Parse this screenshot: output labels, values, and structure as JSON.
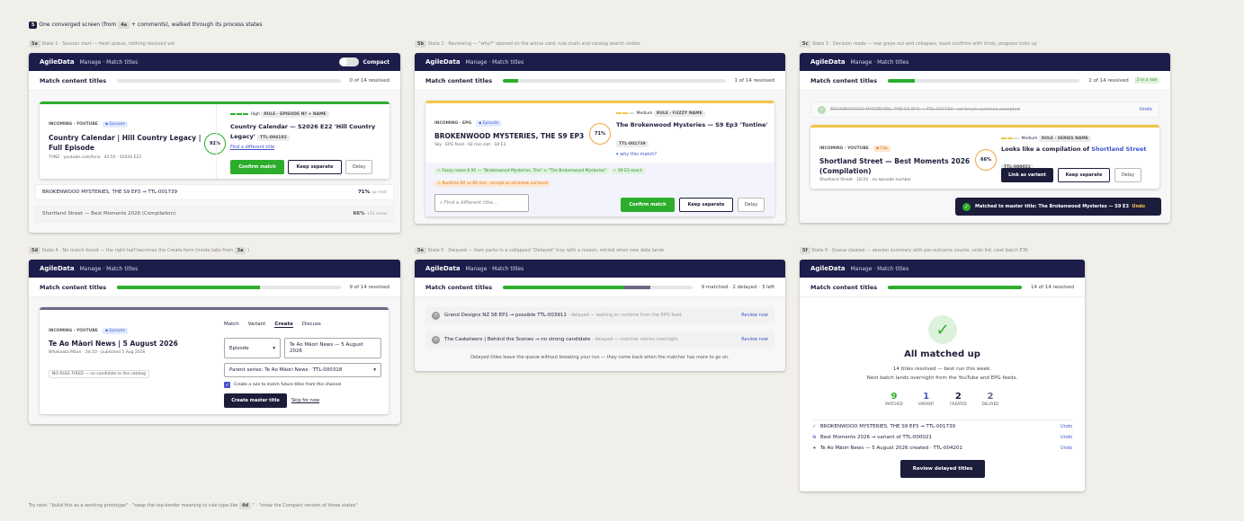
{
  "top": {
    "tag": "5",
    "text": "One converged screen (from",
    "tag2": "4a",
    "text2": "+ comments), walked through its process states"
  },
  "nav": {
    "brand": "AgileData",
    "path": "Manage · Match titles",
    "title": "Match content titles"
  },
  "s1": {
    "tag": "5a",
    "caption": "State 1 · Session start — fresh queue, nothing resolved yet",
    "compact": "Compact",
    "status": "0 of 14 resolved",
    "src": "INCOMING · YOUTUBE",
    "srcpill": "▪ Episode",
    "title": "Country Calendar | Hill Country Legacy | Full Episode",
    "meta": "TVNZ · youtube.com/tvnz · 43:50 · S2026 E22",
    "conf": "High",
    "rule": "RULE · EPISODE Nº + NAME",
    "ring": "92%",
    "match": "Country Calendar — S2026 E22 'Hill Country Legacy'",
    "matchid": "TTL-004182",
    "find": "Find a different title",
    "b1": "Confirm match",
    "b2": "Keep separate",
    "b3": "Delay",
    "q1": "BROKENWOOD MYSTERIES, THE S9 EP3 → TTL-001739",
    "q1p": "71%",
    "q1s": "up next",
    "q2": "Shortland Street — Best Moments 2026 (Compilation)",
    "q2p": "66%",
    "q2s": "+11 more"
  },
  "s2": {
    "tag": "5b",
    "caption": "State 2 · Reviewing — \"why?\" opened on the active card, rule chain and catalog search visible",
    "status": "1 of 14 resolved",
    "src": "INCOMING · EPG",
    "srcpill": "▪ Episode",
    "title": "BROKENWOOD MYSTERIES, THE S9 EP3",
    "meta": "Sky · EPG feed · 92 min slot · S9 E3",
    "conf": "Medium",
    "rule": "RULE · FUZZY NAME",
    "ring": "71%",
    "match": "The Brokenwood Mysteries — S9 Ep3 'Tontine'",
    "matchid": "TTL-001739",
    "why": "▾ why this match?",
    "chip1": "✓ Fuzzy name 0.91 — \"Brokenwood Mysteries, The\" ≈ \"The Brokenwood Mysteries\"",
    "chip2": "✓ S9 E3 exact",
    "chip3": "⚠ Runtime 92 vs 89 min · accept as ad-break variance",
    "search": "Find a different title...",
    "b1": "Confirm match",
    "b2": "Keep separate",
    "b3": "Delay"
  },
  "s3": {
    "tag": "5c",
    "caption": "State 3 · Decision made — row greys out and collapses, toast confirms with Undo, progress ticks up",
    "status": "2 of 14 resolved",
    "streak": "2 in a row",
    "done": "BROKENWOOD MYSTERIES, THE S9 EP3 → TTL-001739 · ad-break variance accepted",
    "undo": "Undo",
    "src": "INCOMING · YOUTUBE",
    "srcpill": "▪ Clip",
    "title": "Shortland Street — Best Moments 2026 (Compilation)",
    "meta": "Shortland Street · 18:24 · no episode number",
    "conf": "Medium",
    "rule": "RULE · SERIES NAME",
    "ring": "66%",
    "match": "Looks like a compilation of",
    "matchlink": "Shortland Street",
    "matchid": "TTL-000021",
    "b1": "Link as variant",
    "b2": "Keep separate",
    "b3": "Delay",
    "toast": "Matched to master title: The Brokenwood Mysteries — S9 E3",
    "toastundo": "Undo"
  },
  "s4": {
    "tag": "5d",
    "caption": "State 4 · No match found — the right half becomes the Create form (mode tabs from",
    "captag": "3a",
    "status": "9 of 14 resolved",
    "src": "INCOMING · YOUTUBE",
    "srcpill": "▪ Episode",
    "title": "Te Ao Māori News | 5 August 2026",
    "meta": "Whakaata Māori · 24:10 · published 5 Aug 2026",
    "norule": "NO RULE FIRED — no candidate in the catalog",
    "tabs": [
      "Match",
      "Variant",
      "Create",
      "Discuss"
    ],
    "type": "Episode",
    "name": "Te Ao Māori News — 5 August 2026",
    "parent": "Parent series: Te Ao Māori News · TTL-000318",
    "check": "Create a rule to match future titles from this channel",
    "b1": "Create master title",
    "skip": "Skip for now"
  },
  "s5": {
    "tag": "5e",
    "caption": "State 5 · Delayed — item parks in a collapsed \"Delayed\" tray with a reason, retried when new data lands",
    "status": "9 matched · 2 delayed · 3 left",
    "r1": "Grand Designs NZ S8 EP1 → possible TTL-003911",
    "r1s": "· delayed — waiting on runtime from the EPG feed",
    "r2": "The Casketeers | Behind the Scenes → no strong candidate",
    "r2s": "· delayed — matcher retries overnight",
    "review": "Review now",
    "foot": "Delayed titles leave the queue without breaking your run — they come back when the matcher has more to go on."
  },
  "s6": {
    "tag": "5f",
    "caption": "State 6 · Queue cleared — session summary with per-outcome counts, undo list, next batch ETA",
    "status": "14 of 14 resolved",
    "heading": "All matched up",
    "sub1": "14 titles resolved — best run this week.",
    "sub2": "Next batch lands overnight from the YouTube and EPG feeds.",
    "stats": [
      {
        "n": "9",
        "l": "MATCHED"
      },
      {
        "n": "1",
        "l": "VARIANT"
      },
      {
        "n": "2",
        "l": "CREATED"
      },
      {
        "n": "2",
        "l": "DELAYED"
      }
    ],
    "log": [
      "BROKENWOOD MYSTERIES, THE S9 EP3 → TTL-001739",
      "Best Moments 2026 → variant of TTL-000021",
      "Te Ao Māori News — 5 August 2026 created · TTL-004201"
    ],
    "undo": "Undo",
    "button": "Review delayed titles"
  },
  "footer": {
    "pre": "Try next: \"build this as a working prototype\" · \"swap the top-border meaning to rule type like",
    "tag": "4d",
    "post": "\" · \"show the Compact version of these states\""
  },
  "colors": {
    "navy": "#1c1d4b",
    "green": "#2cae2c",
    "amber": "#f2a53a",
    "blue": "#4467d8"
  }
}
